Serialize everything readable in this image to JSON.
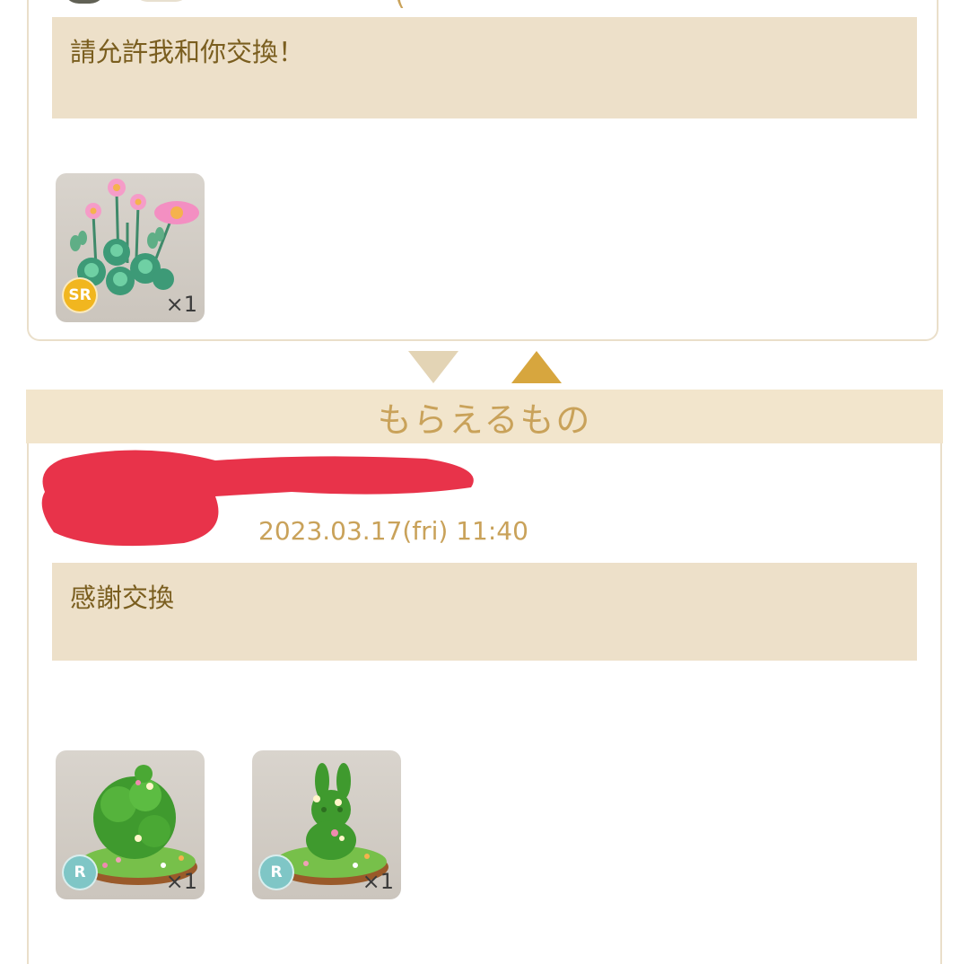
{
  "top_card": {
    "message": "請允許我和你交換！",
    "peek_paren": "(",
    "items": [
      {
        "icon": "pink-flower-succulent",
        "rarity": "SR",
        "quantity": "×1"
      }
    ]
  },
  "arrows": {
    "down_color": "#e3d4b5",
    "up_color": "#d7a63e"
  },
  "bottom_section": {
    "header": "もらえるもの",
    "timestamp": "2023.03.17(fri) 11:40",
    "message": "感謝交換",
    "items": [
      {
        "icon": "round-topiary-bush",
        "rarity": "R",
        "quantity": "×1"
      },
      {
        "icon": "bunny-topiary-bush",
        "rarity": "R",
        "quantity": "×1"
      }
    ]
  },
  "colors": {
    "accent": "#c9a25a",
    "message_bg": "#ede0c9",
    "header_bg": "#f2e5cc",
    "sr_badge": "#f1b61f",
    "r_badge": "#7fc6c6",
    "redaction": "#e8334a"
  }
}
